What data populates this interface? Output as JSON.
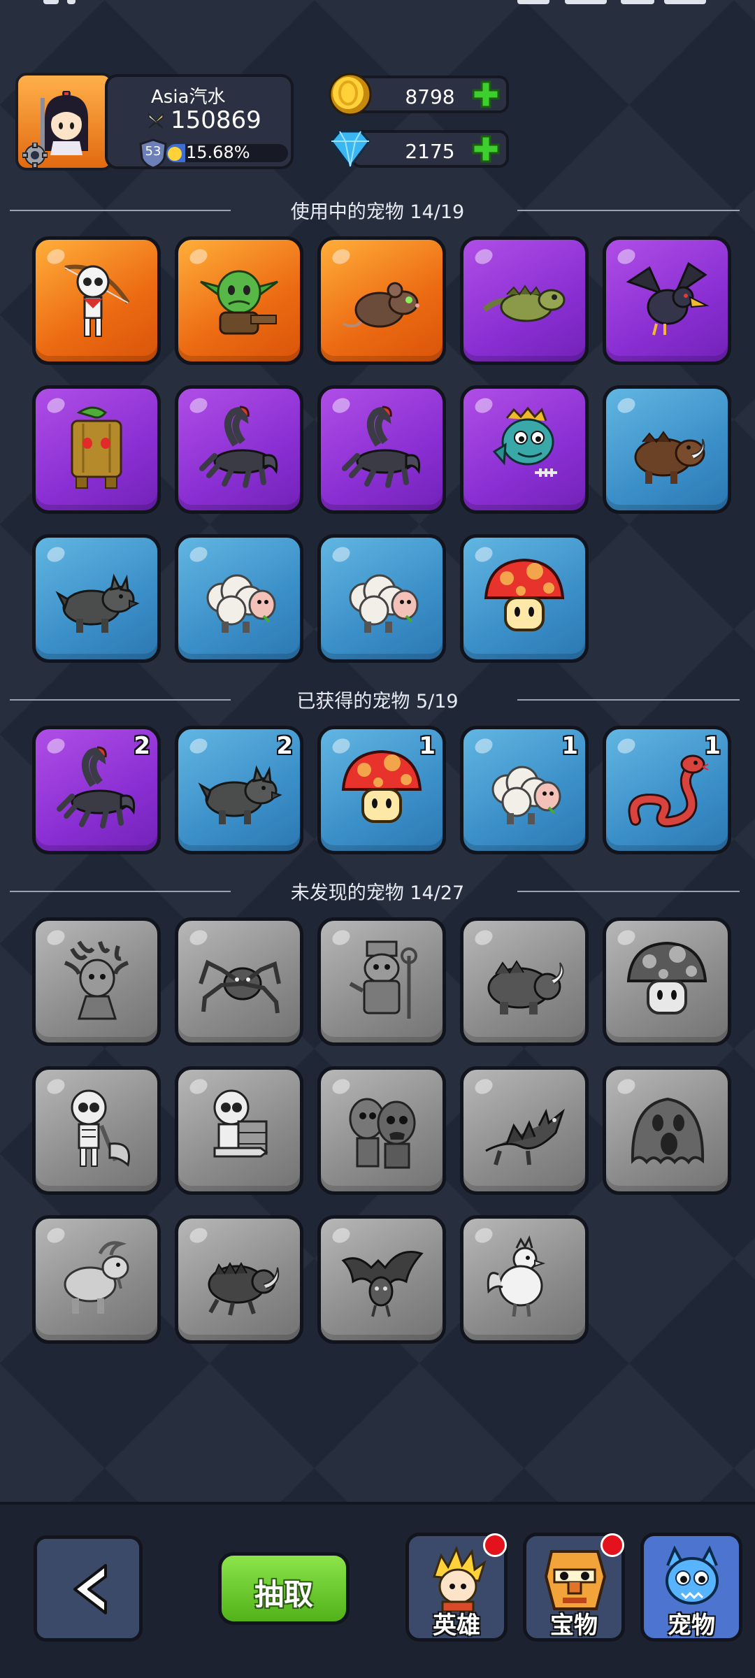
{
  "profile": {
    "name": "Asia汽水",
    "power": "150869",
    "level": "53",
    "xp_percent": "15.68%",
    "xp_fraction": 0.1568
  },
  "currency": {
    "gold": "8798",
    "gems": "2175"
  },
  "sections": {
    "in_use": {
      "title": "使用中的宠物    14/19"
    },
    "obtained": {
      "title": "已获得的宠物    5/19"
    },
    "undiscovered": {
      "title": "未发现的宠物    14/27"
    }
  },
  "pets_in_use": [
    {
      "icon": "skeleton-archer-icon",
      "rarity": "orange"
    },
    {
      "icon": "goblin-icon",
      "rarity": "orange"
    },
    {
      "icon": "rat-icon",
      "rarity": "orange"
    },
    {
      "icon": "lizard-icon",
      "rarity": "purple"
    },
    {
      "icon": "crow-icon",
      "rarity": "purple"
    },
    {
      "icon": "treant-stump-icon",
      "rarity": "purple"
    },
    {
      "icon": "scorpion-icon",
      "rarity": "purple"
    },
    {
      "icon": "scorpion-icon",
      "rarity": "purple"
    },
    {
      "icon": "fish-monster-icon",
      "rarity": "purple"
    },
    {
      "icon": "boar-icon",
      "rarity": "blue"
    },
    {
      "icon": "wolf-icon",
      "rarity": "blue"
    },
    {
      "icon": "sheep-icon",
      "rarity": "blue"
    },
    {
      "icon": "sheep-icon",
      "rarity": "blue"
    },
    {
      "icon": "mushroom-icon",
      "rarity": "blue"
    }
  ],
  "pets_obtained": [
    {
      "icon": "scorpion-icon",
      "rarity": "purple",
      "count": "2"
    },
    {
      "icon": "wolf-icon",
      "rarity": "blue",
      "count": "2"
    },
    {
      "icon": "mushroom-icon",
      "rarity": "blue",
      "count": "1"
    },
    {
      "icon": "sheep-icon",
      "rarity": "blue",
      "count": "1"
    },
    {
      "icon": "snake-icon",
      "rarity": "blue",
      "count": "1"
    }
  ],
  "pets_undiscovered": [
    {
      "icon": "medusa-icon"
    },
    {
      "icon": "spider-icon"
    },
    {
      "icon": "shaman-icon"
    },
    {
      "icon": "rhino-beast-icon"
    },
    {
      "icon": "mushroom-icon"
    },
    {
      "icon": "skeleton-axe-icon"
    },
    {
      "icon": "skeleton-shield-icon"
    },
    {
      "icon": "zombie-pair-icon"
    },
    {
      "icon": "dragon-icon"
    },
    {
      "icon": "slime-ghost-icon"
    },
    {
      "icon": "goat-icon"
    },
    {
      "icon": "beetle-icon"
    },
    {
      "icon": "bat-icon"
    },
    {
      "icon": "rooster-icon"
    }
  ],
  "bottom": {
    "draw_label": "抽取",
    "nav": [
      {
        "label": "英雄",
        "icon": "hero-icon",
        "badge": true,
        "active": false
      },
      {
        "label": "宝物",
        "icon": "treasure-mask-icon",
        "badge": true,
        "active": false
      },
      {
        "label": "宠物",
        "icon": "pet-icon",
        "badge": false,
        "active": true
      }
    ]
  },
  "colors": {
    "orange": "#ec6a12",
    "purple": "#8a2fd3",
    "blue": "#3b8fc8",
    "gray": "#8b8b8b",
    "badge": "#e3121d"
  }
}
